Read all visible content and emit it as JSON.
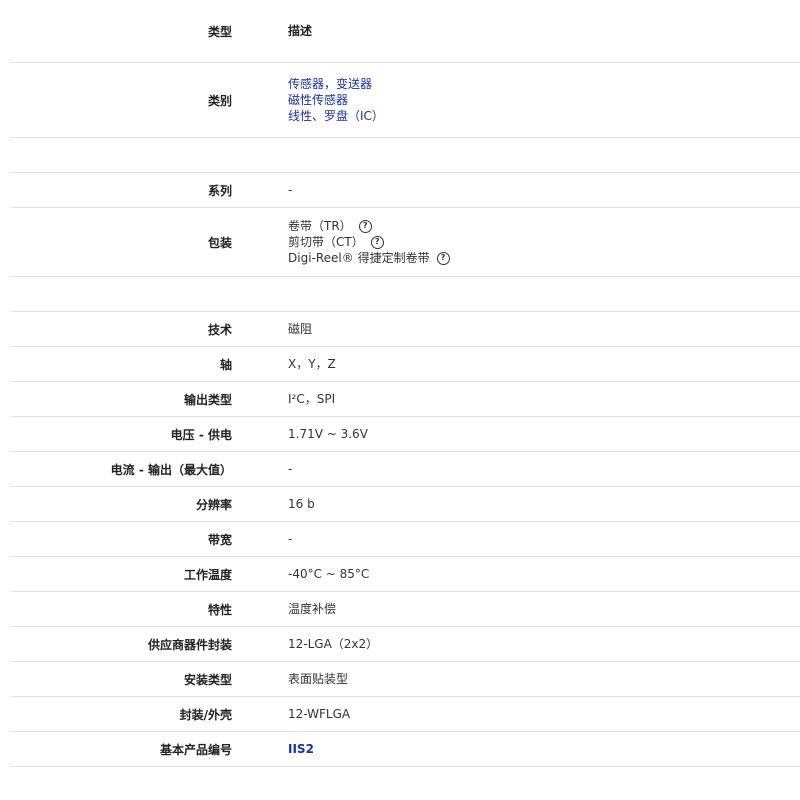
{
  "header": {
    "label": "类型",
    "value": "描述"
  },
  "category": {
    "label": "类别",
    "items": [
      "传感器，变送器",
      "磁性传感器",
      "线性、罗盘（IC）"
    ]
  },
  "series": {
    "label": "系列",
    "value": "-"
  },
  "packaging": {
    "label": "包装",
    "items": [
      {
        "text": "卷带（TR）",
        "help_icon": "question-circle-icon"
      },
      {
        "text": "剪切带（CT）",
        "help_icon": "question-circle-icon"
      },
      {
        "text": "Digi-Reel® 得捷定制卷带",
        "help_icon": "question-circle-icon"
      }
    ]
  },
  "specs": [
    {
      "label": "技术",
      "value": "磁阻"
    },
    {
      "label": "轴",
      "value": "X，Y，Z"
    },
    {
      "label": "输出类型",
      "value": "I²C，SPI"
    },
    {
      "label": "电压 - 供电",
      "value": "1.71V ~ 3.6V"
    },
    {
      "label": "电流 - 输出（最大值）",
      "value": "-"
    },
    {
      "label": "分辨率",
      "value": "16 b"
    },
    {
      "label": "带宽",
      "value": "-"
    },
    {
      "label": "工作温度",
      "value": "-40°C ~ 85°C"
    },
    {
      "label": "特性",
      "value": "温度补偿"
    },
    {
      "label": "供应商器件封装",
      "value": "12-LGA（2x2）"
    },
    {
      "label": "安装类型",
      "value": "表面贴装型"
    },
    {
      "label": "封装/外壳",
      "value": "12-WFLGA"
    }
  ],
  "base_product": {
    "label": "基本产品编号",
    "value": "IIS2"
  }
}
